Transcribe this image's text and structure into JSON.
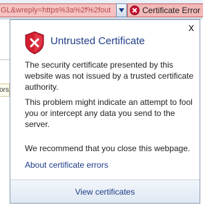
{
  "toolbar": {
    "address_text": "GL&wreply=https%3a%2f%2fout",
    "certificate_error_label": "Certificate Error"
  },
  "left_partial_tab": "ors.",
  "popup": {
    "title": "Untrusted Certificate",
    "paragraph1": "The security certificate presented by this website was not issued by a trusted certificate authority.",
    "paragraph2": "This problem might indicate an attempt to fool you or intercept any data you send to the server.",
    "paragraph3": "We recommend that you close this webpage.",
    "about_link": "About certificate errors",
    "view_link": "View certificates",
    "close_glyph": "x"
  },
  "colors": {
    "error_red": "#c8102e",
    "link_blue": "#1f3c88",
    "address_bg": "#f6c2c2"
  }
}
